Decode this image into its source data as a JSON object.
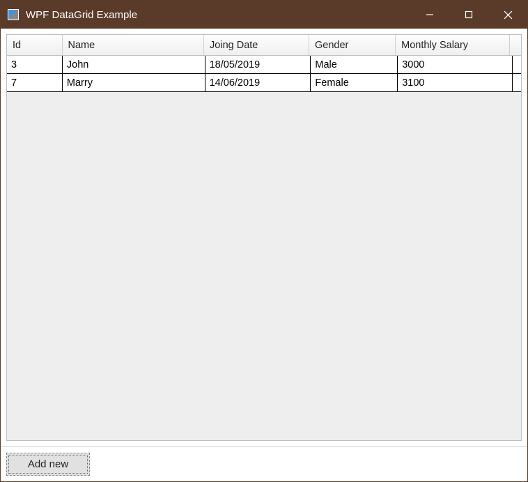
{
  "window": {
    "title": "WPF DataGrid Example"
  },
  "datagrid": {
    "columns": [
      {
        "key": "id",
        "header": "Id"
      },
      {
        "key": "name",
        "header": "Name"
      },
      {
        "key": "date",
        "header": "Joing Date"
      },
      {
        "key": "gender",
        "header": "Gender"
      },
      {
        "key": "salary",
        "header": "Monthly Salary"
      }
    ],
    "rows": [
      {
        "id": "3",
        "name": "John",
        "date": "18/05/2019",
        "gender": "Male",
        "salary": "3000"
      },
      {
        "id": "7",
        "name": "Marry",
        "date": "14/06/2019",
        "gender": "Female",
        "salary": "3100"
      }
    ]
  },
  "buttons": {
    "add_new": "Add new"
  }
}
